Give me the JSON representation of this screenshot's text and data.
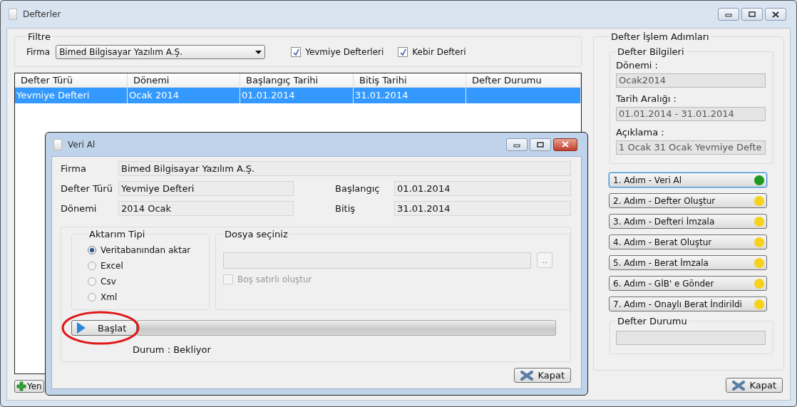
{
  "window": {
    "title": "Defterler"
  },
  "filter": {
    "title": "Filtre",
    "firma_label": "Firma",
    "firma_value": "Bimed Bilgisayar Yazılım A.Ş.",
    "checkboxes": [
      {
        "label": "Yevmiye Defterleri",
        "checked": true
      },
      {
        "label": "Kebir Defteri",
        "checked": true
      }
    ]
  },
  "table": {
    "columns": [
      "Defter Türü",
      "Dönemi",
      "Başlangıç Tarihi",
      "Bitiş Tarihi",
      "Defter Durumu"
    ],
    "rows": [
      {
        "cells": [
          "Yevmiye Defteri",
          "Ocak 2014",
          "01.01.2014",
          "31.01.2014",
          ""
        ],
        "selected": true
      }
    ]
  },
  "new_button": {
    "label": "Yen"
  },
  "steps_panel": {
    "title": "Defter İşlem Adımları",
    "info": {
      "title": "Defter Bilgileri",
      "fields": [
        {
          "label": "Dönemi :",
          "value": "Ocak2014"
        },
        {
          "label": "Tarih Aralığı :",
          "value": "01.01.2014 - 31.01.2014"
        },
        {
          "label": "Açıklama :",
          "value": "1 Ocak 31 Ocak Yevmiye Defte"
        }
      ]
    },
    "steps": [
      {
        "label": "1. Adım - Veri Al",
        "color": "#1e9a1e",
        "selected": true
      },
      {
        "label": "2. Adım - Defter Oluştur",
        "color": "#f6d21a",
        "selected": false
      },
      {
        "label": "3. Adım - Defteri İmzala",
        "color": "#f6d21a",
        "selected": false
      },
      {
        "label": "4. Adım - Berat Oluştur",
        "color": "#f6d21a",
        "selected": false
      },
      {
        "label": "5. Adım - Berat İmzala",
        "color": "#f6d21a",
        "selected": false
      },
      {
        "label": "6. Adım - GİB' e Gönder",
        "color": "#f6d21a",
        "selected": false
      },
      {
        "label": "7. Adım - Onaylı Berat İndirildi",
        "color": "#f6d21a",
        "selected": false
      }
    ],
    "status": {
      "title": "Defter Durumu"
    }
  },
  "close_button": {
    "label": "Kapat"
  },
  "dialog": {
    "title": "Veri Al",
    "firma": {
      "label": "Firma",
      "value": "Bimed Bilgisayar Yazılım A.Ş."
    },
    "left_fields": [
      {
        "label": "Defter Türü",
        "value": "Yevmiye Defteri"
      },
      {
        "label": "Dönemi",
        "value": "2014 Ocak"
      }
    ],
    "right_fields": [
      {
        "label": "Başlangıç",
        "value": "01.01.2014"
      },
      {
        "label": "Bitiş",
        "value": "31.01.2014"
      }
    ],
    "transfer": {
      "title": "Aktarım Tipi",
      "options": [
        {
          "label": "Veritabanından aktar",
          "selected": true
        },
        {
          "label": "Excel",
          "selected": false
        },
        {
          "label": "Csv",
          "selected": false
        },
        {
          "label": "Xml",
          "selected": false
        }
      ]
    },
    "file": {
      "title": "Dosya seçiniz",
      "browse": "..",
      "checkbox": {
        "label": "Boş satırlı oluştur",
        "checked": false,
        "disabled": true
      }
    },
    "start_button": {
      "label": "Başlat",
      "circled": true
    },
    "progress": {
      "level": 0
    },
    "status": "Durum : Bekliyor",
    "close_button": {
      "label": "Kapat"
    }
  }
}
